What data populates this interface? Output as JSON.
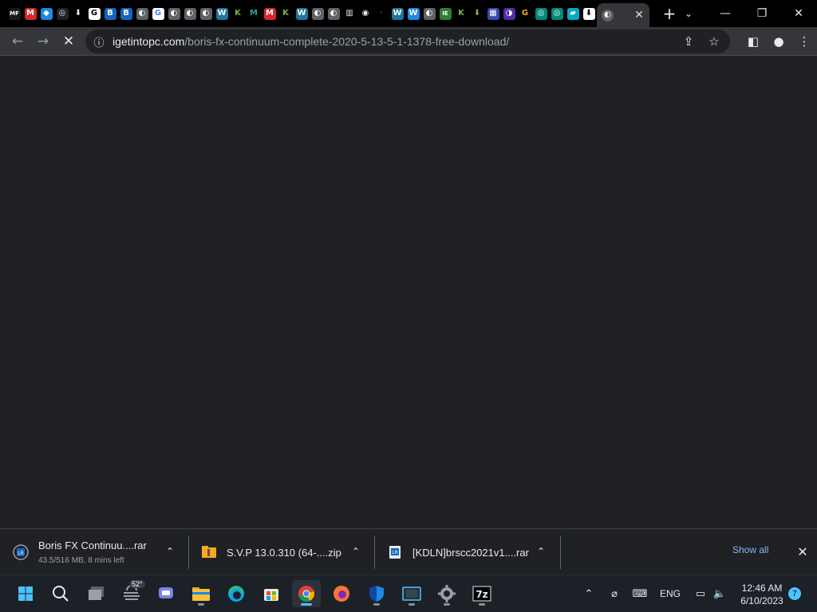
{
  "browser": {
    "tabs": [
      {
        "icon": "mf-icon",
        "glyph": "MF",
        "bg": "#1a1a1a",
        "fg": "#ffffff"
      },
      {
        "icon": "mega-icon",
        "glyph": "M",
        "bg": "#d9272e",
        "fg": "#ffffff"
      },
      {
        "icon": "cloud-icon",
        "glyph": "◆",
        "bg": "#1e88e5",
        "fg": "#ffffff"
      },
      {
        "icon": "chrome-icon",
        "glyph": "◎",
        "bg": "#202124",
        "fg": "#e8eaed"
      },
      {
        "icon": "download-icon",
        "glyph": "⬇",
        "bg": "#000000",
        "fg": "#e8eaed"
      },
      {
        "icon": "g-icon",
        "glyph": "G",
        "bg": "#ffffff",
        "fg": "#000000"
      },
      {
        "icon": "shield-b-icon",
        "glyph": "B",
        "bg": "#1565c0",
        "fg": "#ffffff"
      },
      {
        "icon": "shield-b-icon",
        "glyph": "B",
        "bg": "#1565c0",
        "fg": "#ffffff"
      },
      {
        "icon": "globe-icon",
        "glyph": "◐",
        "bg": "#5f6368",
        "fg": "#ffffff"
      },
      {
        "icon": "google-icon",
        "glyph": "G",
        "bg": "#ffffff",
        "fg": "#4285f4"
      },
      {
        "icon": "globe-icon",
        "glyph": "◐",
        "bg": "#5f6368",
        "fg": "#ffffff"
      },
      {
        "icon": "globe-icon",
        "glyph": "◐",
        "bg": "#5f6368",
        "fg": "#ffffff"
      },
      {
        "icon": "globe-icon",
        "glyph": "◐",
        "bg": "#5f6368",
        "fg": "#ffffff"
      },
      {
        "icon": "wordpress-icon",
        "glyph": "W",
        "bg": "#21759b",
        "fg": "#ffffff"
      },
      {
        "icon": "k-icon",
        "glyph": "K",
        "bg": "#000000",
        "fg": "#7cb342"
      },
      {
        "icon": "m-icon",
        "glyph": "M",
        "bg": "#000000",
        "fg": "#26a69a"
      },
      {
        "icon": "mega-icon",
        "glyph": "M",
        "bg": "#d9272e",
        "fg": "#ffffff"
      },
      {
        "icon": "k-icon",
        "glyph": "K",
        "bg": "#000000",
        "fg": "#7cb342"
      },
      {
        "icon": "wordpress-icon",
        "glyph": "W",
        "bg": "#21759b",
        "fg": "#ffffff"
      },
      {
        "icon": "globe-icon",
        "glyph": "◐",
        "bg": "#5f6368",
        "fg": "#ffffff"
      },
      {
        "icon": "globe-icon",
        "glyph": "◐",
        "bg": "#5f6368",
        "fg": "#ffffff"
      },
      {
        "icon": "archive-icon",
        "glyph": "▥",
        "bg": "#000000",
        "fg": "#e8eaed"
      },
      {
        "icon": "github-icon",
        "glyph": "◉",
        "bg": "#000000",
        "fg": "#e8eaed"
      },
      {
        "icon": "dark-icon",
        "glyph": "·",
        "bg": "#000000",
        "fg": "#555555"
      },
      {
        "icon": "wordpress-icon",
        "glyph": "W",
        "bg": "#21759b",
        "fg": "#ffffff"
      },
      {
        "icon": "w-icon",
        "glyph": "W",
        "bg": "#1e88e5",
        "fg": "#ffffff"
      },
      {
        "icon": "globe-icon",
        "glyph": "◐",
        "bg": "#5f6368",
        "fg": "#ffffff"
      },
      {
        "icon": "ie-icon",
        "glyph": "IE",
        "bg": "#2e7d32",
        "fg": "#ffffff"
      },
      {
        "icon": "k-icon",
        "glyph": "K",
        "bg": "#000000",
        "fg": "#7cb342"
      },
      {
        "icon": "download-green-icon",
        "glyph": "⬇",
        "bg": "#000000",
        "fg": "#7cb342"
      },
      {
        "icon": "grid-icon",
        "glyph": "▦",
        "bg": "#3949ab",
        "fg": "#ffffff"
      },
      {
        "icon": "moon-icon",
        "glyph": "◑",
        "bg": "#512da8",
        "fg": "#ffffff"
      },
      {
        "icon": "g-icon",
        "glyph": "G",
        "bg": "#000000",
        "fg": "#f9a825"
      },
      {
        "icon": "circle-green-icon",
        "glyph": "◎",
        "bg": "#00897b",
        "fg": "#ffffff"
      },
      {
        "icon": "circle-green-icon",
        "glyph": "◎",
        "bg": "#00897b",
        "fg": "#ffffff"
      },
      {
        "icon": "book-icon",
        "glyph": "▰",
        "bg": "#00acc1",
        "fg": "#ffffff"
      },
      {
        "icon": "download-box-icon",
        "glyph": "⬇",
        "bg": "#ffffff",
        "fg": "#000000"
      }
    ],
    "active_tab": {
      "icon": "globe-icon",
      "close": "✕"
    },
    "new_tab": "+",
    "tab_search": "⌄",
    "window_controls": {
      "minimize": "—",
      "restore": "❐",
      "close": "✕"
    },
    "nav": {
      "back": "←",
      "forward": "→",
      "stop": "✕"
    },
    "omnibox": {
      "info_icon": "ⓘ",
      "domain": "igetintopc.com",
      "path": "/boris-fx-continuum-complete-2020-5-13-5-1-1378-free-download/",
      "share_icon": "⇪",
      "bookmark_icon": "☆"
    },
    "toolbar_right": {
      "sidepanel": "◧",
      "profile": "●",
      "menu": "⋮"
    }
  },
  "downloads": {
    "items": [
      {
        "name": "Boris FX Continuu....rar",
        "status": "43.5/516 MB, 8 mins left",
        "icon_color": "#1565c0"
      },
      {
        "name": "S.V.P 13.0.310 (64-....zip",
        "status": "",
        "icon_color": "#f9a825"
      },
      {
        "name": "[KDLN]brscc2021v1....rar",
        "status": "",
        "icon_color": "#1565c0"
      }
    ],
    "chevron": "⌃",
    "show_all": "Show all",
    "close": "✕"
  },
  "taskbar": {
    "weather_temp": "52°",
    "apps": [
      {
        "name": "start-button",
        "icon": "windows-icon",
        "color": "#4cc2ff",
        "active": false,
        "open": false
      },
      {
        "name": "search-button",
        "icon": "search-icon",
        "color": "#e8eaed",
        "active": false,
        "open": false
      },
      {
        "name": "task-view-button",
        "icon": "task-view-icon",
        "color": "#9aa0a6",
        "active": false,
        "open": false
      },
      {
        "name": "weather-widget",
        "icon": "weather-icon",
        "color": "#9aa0a6",
        "active": false,
        "open": false
      },
      {
        "name": "teams-chat-button",
        "icon": "chat-icon",
        "color": "#7b83eb",
        "active": false,
        "open": false
      },
      {
        "name": "file-explorer-button",
        "icon": "folder-icon",
        "color": "#f9c13c",
        "active": false,
        "open": true
      },
      {
        "name": "edge-button",
        "icon": "edge-icon",
        "color": "#0ea5e9",
        "active": false,
        "open": false
      },
      {
        "name": "store-button",
        "icon": "store-icon",
        "color": "#f25022",
        "active": false,
        "open": false
      },
      {
        "name": "chrome-button",
        "icon": "chrome-icon",
        "color": "#4285f4",
        "active": true,
        "open": true
      },
      {
        "name": "firefox-button",
        "icon": "firefox-icon",
        "color": "#ff7139",
        "active": false,
        "open": false
      },
      {
        "name": "defender-button",
        "icon": "defender-icon",
        "color": "#1e88e5",
        "active": false,
        "open": true
      },
      {
        "name": "media-app-button",
        "icon": "film-icon",
        "color": "#4cc2ff",
        "active": false,
        "open": true
      },
      {
        "name": "settings-button",
        "icon": "gear-icon",
        "color": "#9aa0a6",
        "active": false,
        "open": true
      },
      {
        "name": "7zip-button",
        "icon": "7zip-icon",
        "color": "#e8eaed",
        "active": false,
        "open": true
      }
    ],
    "tray": {
      "chevron": "⌃",
      "network_icon": "⌀",
      "keyboard_icon": "⌨",
      "lang": "ENG",
      "display_icon": "▭",
      "volume_icon": "🔈",
      "time": "12:46 AM",
      "date": "6/10/2023",
      "notifications": "7"
    }
  }
}
